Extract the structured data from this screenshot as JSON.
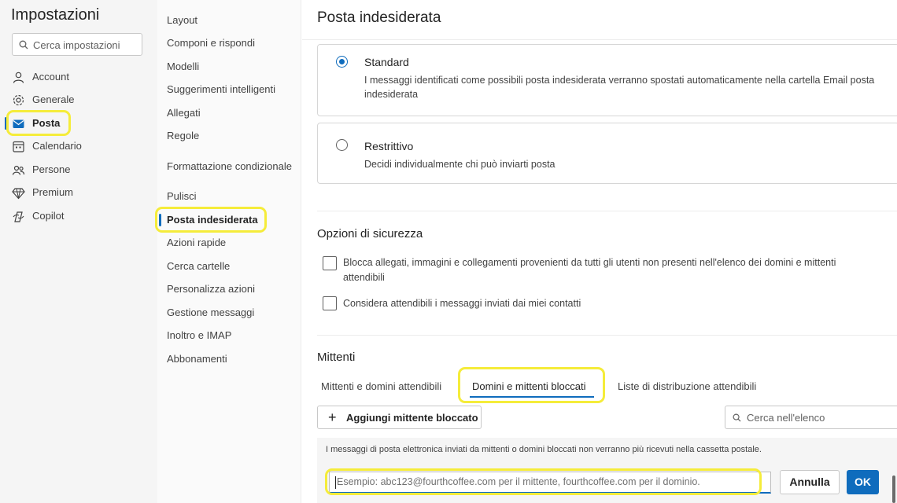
{
  "app_title": "Impostazioni",
  "search": {
    "placeholder": "Cerca impostazioni"
  },
  "categories": [
    {
      "label": "Account",
      "icon": "person-icon"
    },
    {
      "label": "Generale",
      "icon": "gear-icon"
    },
    {
      "label": "Posta",
      "icon": "mail-icon",
      "active": true
    },
    {
      "label": "Calendario",
      "icon": "calendar-icon"
    },
    {
      "label": "Persone",
      "icon": "people-icon"
    },
    {
      "label": "Premium",
      "icon": "diamond-icon"
    },
    {
      "label": "Copilot",
      "icon": "copilot-icon"
    }
  ],
  "subnav": [
    "Layout",
    "Componi e rispondi",
    "Modelli",
    "Suggerimenti intelligenti",
    "Allegati",
    "Regole",
    "Formattazione condizionale",
    "Pulisci",
    "Posta indesiderata",
    "Azioni rapide",
    "Cerca cartelle",
    "Personalizza azioni",
    "Gestione messaggi",
    "Inoltro e IMAP",
    "Abbonamenti"
  ],
  "subnav_active": "Posta indesiderata",
  "page": {
    "title": "Posta indesiderata",
    "filter_options": [
      {
        "title": "Standard",
        "desc": "I messaggi identificati come possibili posta indesiderata verranno spostati automaticamente nella cartella Email posta indesiderata",
        "selected": true
      },
      {
        "title": "Restrittivo",
        "desc": "Decidi individualmente chi può inviarti posta",
        "selected": false
      }
    ],
    "security": {
      "title": "Opzioni di sicurezza",
      "options": [
        {
          "label": "Blocca allegati, immagini e collegamenti provenienti da tutti gli utenti non presenti nell'elenco dei domini e mittenti attendibili",
          "checked": false
        },
        {
          "label": "Considera attendibili i messaggi inviati dai miei contatti",
          "checked": false
        }
      ]
    },
    "senders": {
      "title": "Mittenti",
      "tabs": [
        "Mittenti e domini attendibili",
        "Domini e mittenti bloccati",
        "Liste di distribuzione attendibili"
      ],
      "active_tab": "Domini e mittenti bloccati",
      "add_button": "Aggiungi mittente bloccato",
      "list_search_placeholder": "Cerca nell'elenco",
      "notice": "I messaggi di posta elettronica inviati da mittenti o domini bloccati non verranno più ricevuti nella cassetta postale.",
      "entry_placeholder": "Esempio: abc123@fourthcoffee.com per il mittente, fourthcoffee.com per il dominio.",
      "cancel_label": "Annulla",
      "ok_label": "OK"
    }
  },
  "colors": {
    "accent": "#0f6cbd",
    "highlight": "#f5ec3a",
    "nav_bg": "#f5f5f5"
  }
}
